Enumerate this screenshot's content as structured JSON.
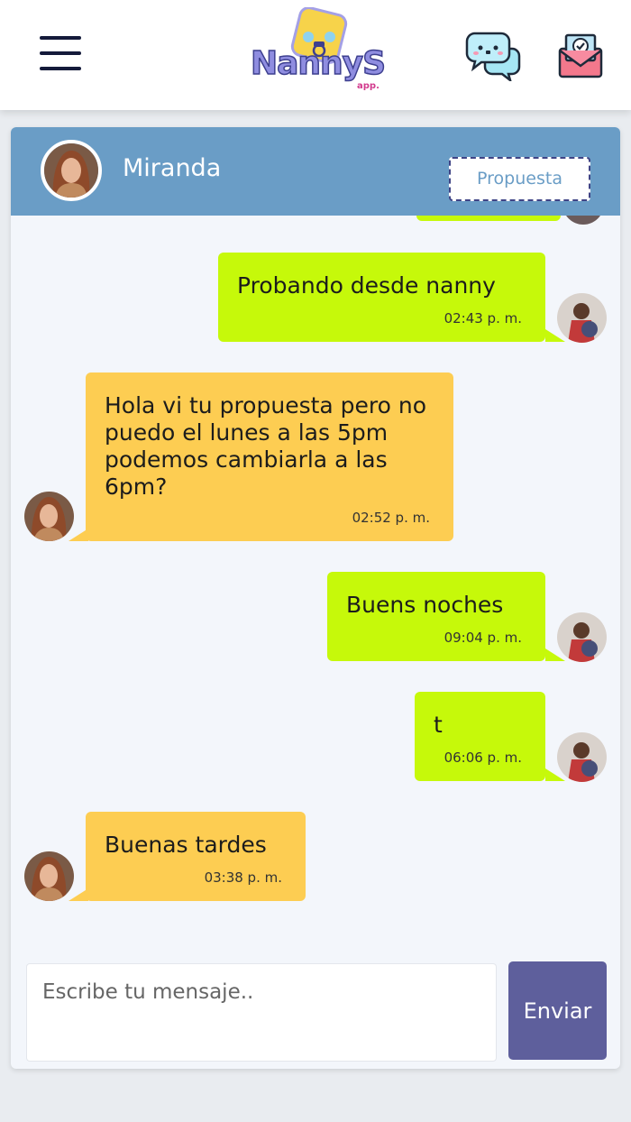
{
  "app": {
    "logo_text": "NannyS",
    "logo_sub": "app."
  },
  "nav": {
    "menu_icon": "hamburger-menu-icon",
    "chat_icon": "chat-bubbles-icon",
    "mail_icon": "envelope-check-icon"
  },
  "chat": {
    "contact_name": "Miranda",
    "proposal_label": "Propuesta",
    "messages": [
      {
        "direction": "sent",
        "text": "Probando desde nanny",
        "time": "02:43 p. m."
      },
      {
        "direction": "received",
        "text": "Hola vi tu propuesta pero no puedo el lunes a las 5pm podemos cambiarla a las 6pm?",
        "time": "02:52 p. m."
      },
      {
        "direction": "sent",
        "text": "Buens noches",
        "time": "09:04 p. m."
      },
      {
        "direction": "sent",
        "text": "t",
        "time": "06:06 p. m."
      },
      {
        "direction": "received",
        "text": "Buenas tardes",
        "time": "03:38 p. m."
      }
    ]
  },
  "composer": {
    "placeholder": "Escribe tu mensaje..",
    "value": "",
    "send_label": "Enviar"
  },
  "colors": {
    "header_blue": "#6a9dc6",
    "sent_bubble": "#c6f90a",
    "received_bubble": "#fdcd52",
    "send_button": "#5e5f9c"
  }
}
